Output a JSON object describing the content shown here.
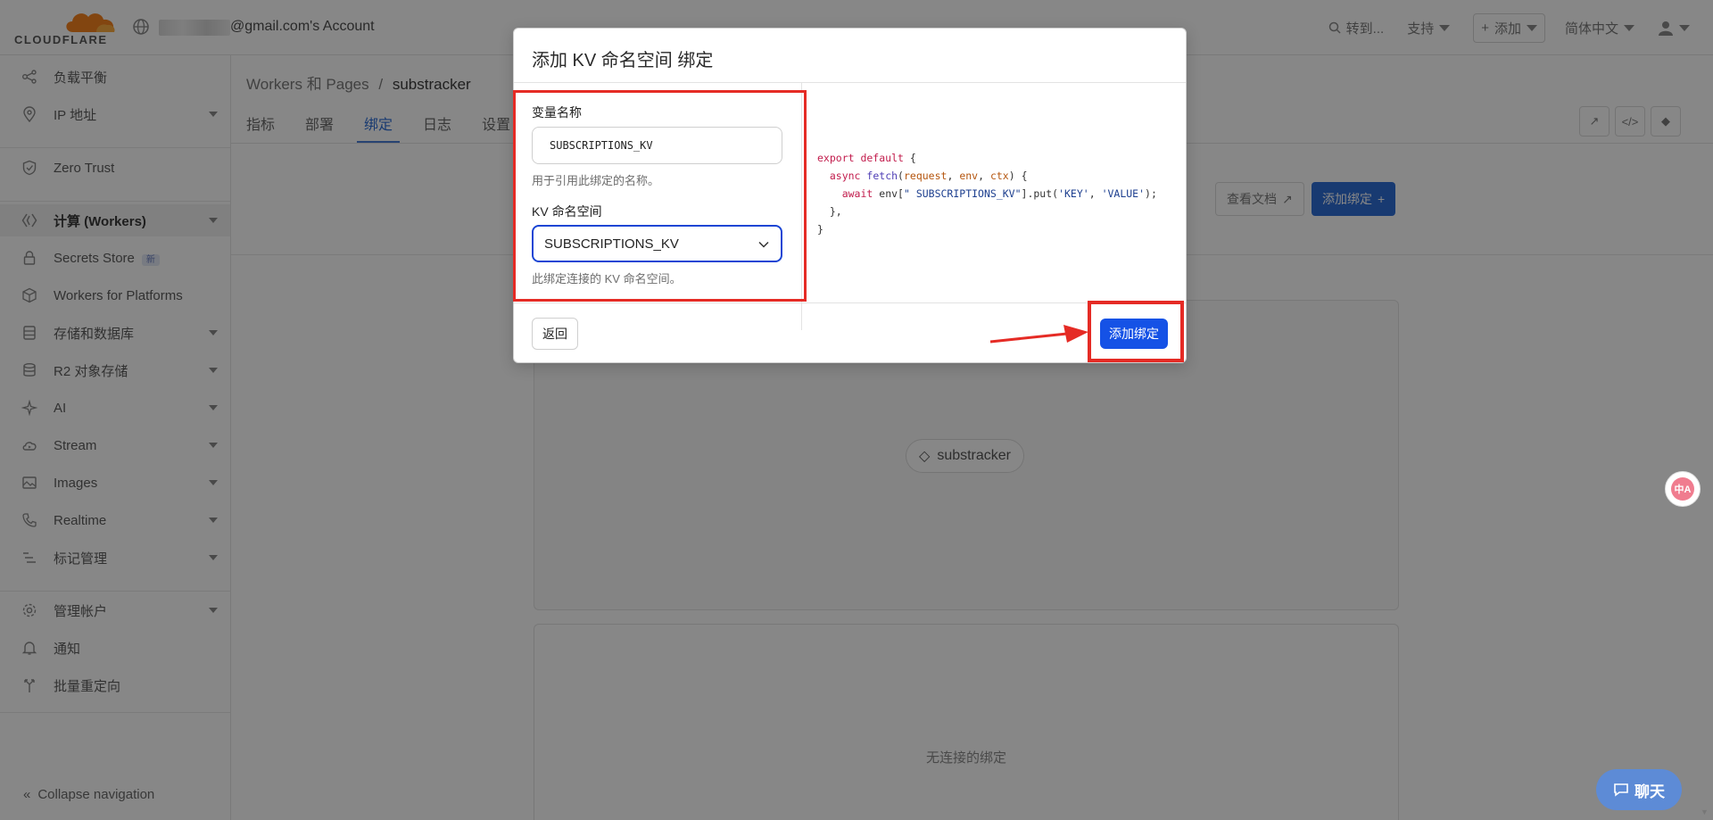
{
  "topbar": {
    "logo_text": "CLOUDFLARE",
    "account_text": "@gmail.com's Account",
    "search_label": "转到...",
    "support_label": "支持",
    "add_label": "添加",
    "language_label": "简体中文"
  },
  "sidebar": {
    "items": [
      {
        "label": "负载平衡",
        "icon": "load-balancing-icon"
      },
      {
        "label": "IP 地址",
        "icon": "location-pin-icon"
      },
      {
        "label": "Zero Trust",
        "icon": "shield-icon"
      },
      {
        "label": "计算 (Workers)",
        "icon": "workers-icon"
      },
      {
        "label": "Secrets Store",
        "icon": "lock-icon",
        "badge": "新"
      },
      {
        "label": "Workers for Platforms",
        "icon": "cube-icon"
      },
      {
        "label": "存储和数据库",
        "icon": "database-icon"
      },
      {
        "label": "R2 对象存储",
        "icon": "storage-icon"
      },
      {
        "label": "AI",
        "icon": "ai-sparkle-icon"
      },
      {
        "label": "Stream",
        "icon": "cloud-icon"
      },
      {
        "label": "Images",
        "icon": "image-icon"
      },
      {
        "label": "Realtime",
        "icon": "phone-icon"
      },
      {
        "label": "标记管理",
        "icon": "tag-manager-icon"
      },
      {
        "label": "管理帐户",
        "icon": "gear-icon"
      },
      {
        "label": "通知",
        "icon": "bell-icon"
      },
      {
        "label": "批量重定向",
        "icon": "redirect-icon"
      }
    ],
    "collapse_label": "Collapse navigation"
  },
  "main": {
    "breadcrumb_parent": "Workers 和 Pages",
    "breadcrumb_sep": "/",
    "breadcrumb_current": "substracker",
    "tabs": [
      "指标",
      "部署",
      "绑定",
      "日志",
      "设置"
    ],
    "docs_button": "查看文档",
    "add_binding_button": "添加绑定",
    "worker_node": "substracker",
    "no_bindings_text": "无连接的绑定"
  },
  "modal": {
    "title": "添加 KV 命名空间 绑定",
    "var_label": "变量名称",
    "var_value": "SUBSCRIPTIONS_KV",
    "var_help": "用于引用此绑定的名称。",
    "ns_label": "KV 命名空间",
    "ns_value": "SUBSCRIPTIONS_KV",
    "ns_help": "此绑定连接的 KV 命名空间。",
    "code": {
      "line1_kw": "export default",
      "line1_rest": " {",
      "line2_kw": "async",
      "line2_fn": "fetch",
      "line2_p1": "request",
      "line2_p2": "env",
      "line2_p3": "ctx",
      "line3_kw": "await",
      "line3_env": "env[",
      "line3_str": "\" SUBSCRIPTIONS_KV\"",
      "line3_put": "].put(",
      "line3_k": "'KEY'",
      "line3_v": "'VALUE'",
      "line4": "},",
      "line5": "}"
    },
    "back_button": "返回",
    "submit_button": "添加绑定"
  },
  "widgets": {
    "translate_label": "中A",
    "chat_label": "聊天"
  },
  "colors": {
    "primary": "#1552e6",
    "annotation_red": "#e52b25",
    "cloudflare_orange": "#f38020"
  }
}
